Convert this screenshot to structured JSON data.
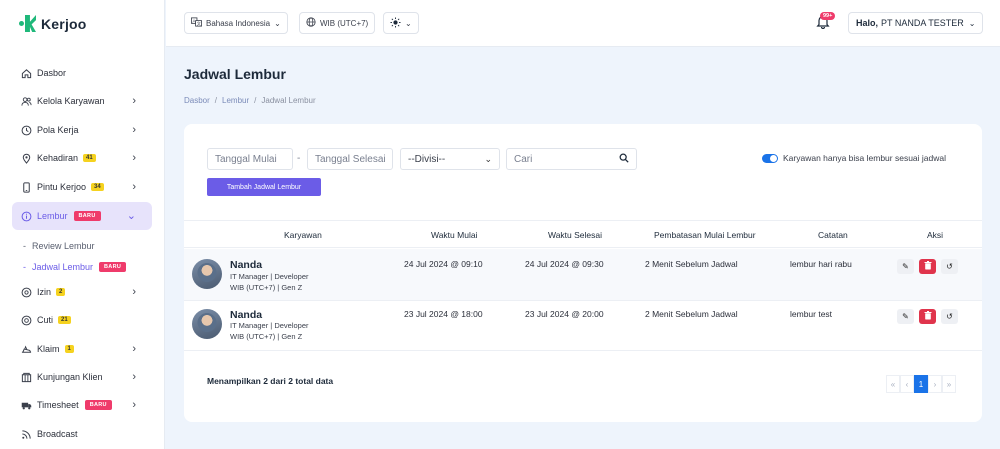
{
  "brand": {
    "name": "Kerjoo"
  },
  "topbar": {
    "language": "Bahasa Indonesia",
    "timezone": "WIB (UTC+7)",
    "notif_count": "99+",
    "greeting": "Halo,",
    "user": "PT NANDA TESTER"
  },
  "sidebar": {
    "items": [
      {
        "label": "Dasbor"
      },
      {
        "label": "Kelola Karyawan"
      },
      {
        "label": "Pola Kerja"
      },
      {
        "label": "Kehadiran",
        "badge": "41"
      },
      {
        "label": "Pintu Kerjoo",
        "badge": "34"
      },
      {
        "label": "Lembur",
        "badge": "BARU"
      },
      {
        "label": "Izin",
        "badge": "2"
      },
      {
        "label": "Cuti",
        "badge": "21"
      },
      {
        "label": "Klaim",
        "badge": "1"
      },
      {
        "label": "Kunjungan Klien"
      },
      {
        "label": "Timesheet",
        "badge": "BARU"
      },
      {
        "label": "Broadcast"
      }
    ],
    "sub_items": [
      {
        "label": "Review Lembur"
      },
      {
        "label": "Jadwal Lembur",
        "badge": "BARU"
      }
    ]
  },
  "page": {
    "title": "Jadwal Lembur",
    "breadcrumb": [
      "Dasbor",
      "Lembur",
      "Jadwal Lembur"
    ]
  },
  "filters": {
    "start_placeholder": "Tanggal Mulai",
    "end_placeholder": "Tanggal Selesai",
    "division": "--Divisi--",
    "search_placeholder": "Cari",
    "add_button": "Tambah Jadwal Lembur",
    "toggle_label": "Karyawan hanya bisa lembur sesuai jadwal"
  },
  "table": {
    "headers": [
      "Karyawan",
      "Waktu Mulai",
      "Waktu Selesai",
      "Pembatasan Mulai Lembur",
      "Catatan",
      "Aksi"
    ],
    "rows": [
      {
        "name": "Nanda",
        "position": "IT Manager | Developer",
        "info": "WIB (UTC+7) | Gen Z",
        "start": "24 Jul 2024 @ 09:10",
        "end": "24 Jul 2024 @ 09:30",
        "restriction": "2 Menit Sebelum Jadwal",
        "note": "lembur hari rabu"
      },
      {
        "name": "Nanda",
        "position": "IT Manager | Developer",
        "info": "WIB (UTC+7) | Gen Z",
        "start": "23 Jul 2024 @ 18:00",
        "end": "23 Jul 2024 @ 20:00",
        "restriction": "2 Menit Sebelum Jadwal",
        "note": "lembur test"
      }
    ]
  },
  "footer": {
    "summary": "Menampilkan 2 dari 2 total data",
    "pager": {
      "first": "«",
      "prev": "‹",
      "current": "1",
      "next": "›",
      "last": "»"
    }
  }
}
